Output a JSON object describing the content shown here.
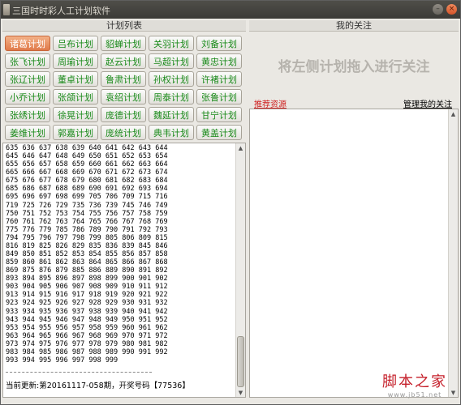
{
  "window": {
    "title": "三国时时彩人工计划软件",
    "minimize_glyph": "–",
    "close_glyph": "×"
  },
  "left": {
    "header": "计划列表",
    "buttons": [
      [
        "诸葛计划",
        "吕布计划",
        "貂蝉计划",
        "关羽计划",
        "刘备计划"
      ],
      [
        "张飞计划",
        "周瑜计划",
        "赵云计划",
        "马超计划",
        "黄忠计划"
      ],
      [
        "张辽计划",
        "董卓计划",
        "鲁肃计划",
        "孙权计划",
        "许褚计划"
      ],
      [
        "小乔计划",
        "张颌计划",
        "袁绍计划",
        "周泰计划",
        "张鲁计划"
      ],
      [
        "张绣计划",
        "徐晃计划",
        "庞德计划",
        "魏延计划",
        "甘宁计划"
      ],
      [
        "姜维计划",
        "郭嘉计划",
        "庞统计划",
        "典韦计划",
        "黄盖计划"
      ]
    ],
    "active_button": "诸葛计划"
  },
  "log": {
    "lines": [
      "635 636 637 638 639 640 641 642 643 644",
      "645 646 647 648 649 650 651 652 653 654",
      "655 656 657 658 659 660 661 662 663 664",
      "665 666 667 668 669 670 671 672 673 674",
      "675 676 677 678 679 680 681 682 683 684",
      "685 686 687 688 689 690 691 692 693 694",
      "695 696 697 698 699 705 706 709 715 716",
      "719 725 726 729 735 736 739 745 746 749",
      "750 751 752 753 754 755 756 757 758 759",
      "760 761 762 763 764 765 766 767 768 769",
      "775 776 779 785 786 789 790 791 792 793",
      "794 795 796 797 798 799 805 806 809 815",
      "816 819 825 826 829 835 836 839 845 846",
      "849 850 851 852 853 854 855 856 857 858",
      "859 860 861 862 863 864 865 866 867 868",
      "869 875 876 879 885 886 889 890 891 892",
      "893 894 895 896 897 898 899 900 901 902",
      "903 904 905 906 907 908 909 910 911 912",
      "913 914 915 916 917 918 919 920 921 922",
      "923 924 925 926 927 928 929 930 931 932",
      "933 934 935 936 937 938 939 940 941 942",
      "943 944 945 946 947 948 949 950 951 952",
      "953 954 955 956 957 958 959 960 961 962",
      "963 964 965 966 967 968 969 970 971 972",
      "973 974 975 976 977 978 979 980 981 982",
      "983 984 985 986 987 988 989 990 991 992",
      "993 994 995 996 997 998 999"
    ],
    "status": "当前更新:第20161117-058期，开奖号码【77536】",
    "scroll_up_glyph": "▲",
    "scroll_down_glyph": "▼"
  },
  "right": {
    "header": "我的关注",
    "hint": "将左侧计划拖入进行关注",
    "recommend_link": "推荐资源",
    "manage_link": "管理我的关注"
  },
  "watermark": {
    "main": "脚本之家",
    "sub": "www.jb51.net"
  },
  "colors": {
    "active_button": "#e07a4a",
    "button_text": "#1a8a1a",
    "recommend_link": "#d02020",
    "titlebar": "#3b3a36"
  }
}
